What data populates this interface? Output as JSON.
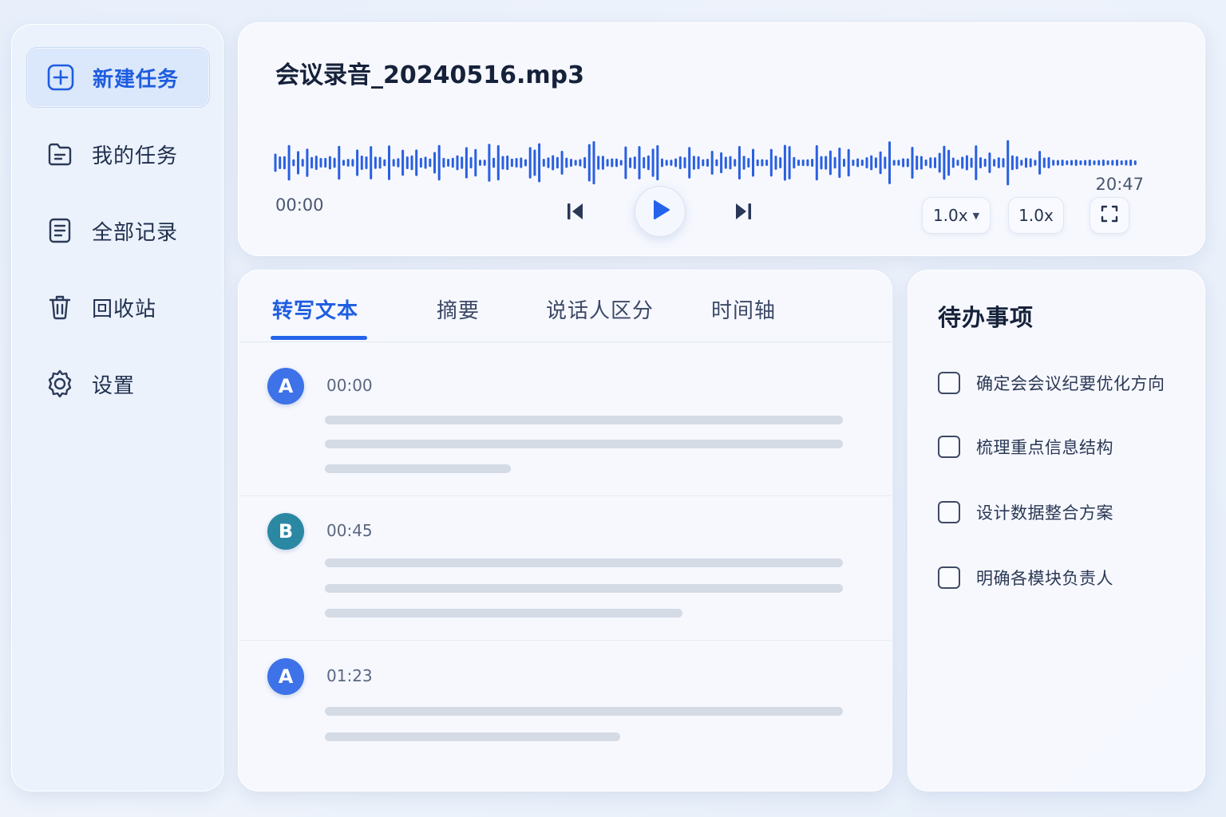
{
  "sidebar": {
    "items": [
      {
        "label": "新建任务",
        "icon": "plus-square-icon",
        "active": true
      },
      {
        "label": "我的任务",
        "icon": "folder-icon",
        "active": false
      },
      {
        "label": "全部记录",
        "icon": "document-list-icon",
        "active": false
      },
      {
        "label": "回收站",
        "icon": "trash-icon",
        "active": false
      },
      {
        "label": "设置",
        "icon": "gear-icon",
        "active": false
      }
    ]
  },
  "player": {
    "file_name": "会议录音_20240516.mp3",
    "current_time": "00:00",
    "total_time": "20:47",
    "speed_select": "1.0x",
    "speed_button": "1.0x"
  },
  "transcript": {
    "tabs": [
      {
        "label": "转写文本",
        "active": true
      },
      {
        "label": "摘要",
        "active": false
      },
      {
        "label": "说话人区分",
        "active": false
      },
      {
        "label": "时间轴",
        "active": false
      }
    ],
    "segments": [
      {
        "speaker": "A",
        "time": "00:00"
      },
      {
        "speaker": "B",
        "time": "00:45"
      },
      {
        "speaker": "A",
        "time": "01:23"
      }
    ]
  },
  "todo": {
    "title": "待办事项",
    "items": [
      {
        "label": "确定会会议纪要优化方向",
        "checked": false
      },
      {
        "label": "梳理重点信息结构",
        "checked": false
      },
      {
        "label": "设计数据整合方案",
        "checked": false
      },
      {
        "label": "明确各模块负责人",
        "checked": false
      }
    ]
  },
  "colors": {
    "accent": "#2563eb",
    "speaker_a": "#3d72e8",
    "speaker_b": "#2b88a3"
  }
}
